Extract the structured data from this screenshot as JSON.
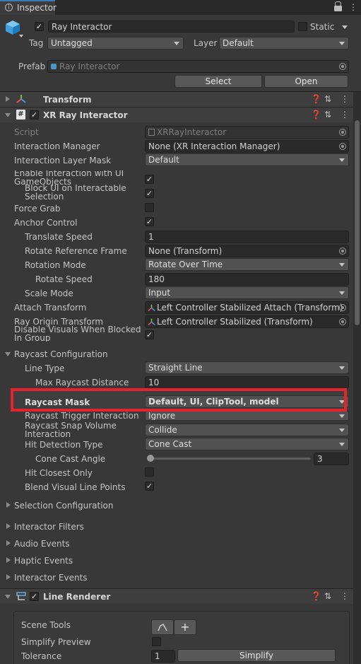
{
  "tab": {
    "title": "Inspector"
  },
  "object": {
    "name": "Ray Interactor",
    "static_label": "Static",
    "tag_label": "Tag",
    "tag_value": "Untagged",
    "layer_label": "Layer",
    "layer_value": "Default",
    "prefab_label": "Prefab",
    "prefab_value": "Ray Interactor",
    "select_label": "Select",
    "open_label": "Open"
  },
  "transform": {
    "title": "Transform"
  },
  "xr": {
    "title": "XR Ray Interactor",
    "script_label": "Script",
    "script_value": "XRRayInteractor",
    "interaction_manager_label": "Interaction Manager",
    "interaction_manager_value": "None (XR Interaction Manager)",
    "interaction_layer_mask_label": "Interaction Layer Mask",
    "interaction_layer_mask_value": "Default",
    "enable_ui_label": "Enable Interaction with UI GameObjects",
    "block_ui_label": "Block UI on Interactable Selection",
    "force_grab_label": "Force Grab",
    "anchor_control_label": "Anchor Control",
    "translate_speed_label": "Translate Speed",
    "translate_speed_value": "1",
    "rotate_ref_label": "Rotate Reference Frame",
    "rotate_ref_value": "None (Transform)",
    "rotation_mode_label": "Rotation Mode",
    "rotation_mode_value": "Rotate Over Time",
    "rotate_speed_label": "Rotate Speed",
    "rotate_speed_value": "180",
    "scale_mode_label": "Scale Mode",
    "scale_mode_value": "Input",
    "attach_transform_label": "Attach Transform",
    "attach_transform_value": "Left Controller Stabilized Attach (Transform)",
    "ray_origin_label": "Ray Origin Transform",
    "ray_origin_value": "Left Controller Stabilized (Transform)",
    "disable_visuals_label": "Disable Visuals When Blocked In Group"
  },
  "raycast": {
    "title": "Raycast Configuration",
    "line_type_label": "Line Type",
    "line_type_value": "Straight Line",
    "max_distance_label": "Max Raycast Distance",
    "max_distance_value": "10",
    "mask_label": "Raycast Mask",
    "mask_value": "Default, UI, ClipTool, model",
    "trigger_label": "Raycast Trigger Interaction",
    "trigger_value": "Ignore",
    "snap_label": "Raycast Snap Volume Interaction",
    "snap_value": "Collide",
    "hit_type_label": "Hit Detection Type",
    "hit_type_value": "Cone Cast",
    "cone_angle_label": "Cone Cast Angle",
    "cone_angle_value": "3",
    "cone_angle_fraction": 0.0,
    "hit_closest_label": "Hit Closest Only",
    "blend_label": "Blend Visual Line Points"
  },
  "foldouts": {
    "selection": "Selection Configuration",
    "filters": "Interactor Filters",
    "audio": "Audio Events",
    "haptic": "Haptic Events",
    "interactor": "Interactor Events"
  },
  "line_renderer": {
    "title": "Line Renderer",
    "scene_tools_label": "Scene Tools",
    "simplify_preview_label": "Simplify Preview",
    "tolerance_label": "Tolerance",
    "tolerance_value": "1",
    "simplify_label": "Simplify"
  },
  "checks": {
    "object_active": true,
    "static": false,
    "xr_enabled": true,
    "enable_ui": true,
    "block_ui": true,
    "force_grab": false,
    "anchor_control": true,
    "disable_visuals": true,
    "hit_closest": false,
    "blend": true,
    "lr_enabled": true,
    "simplify_preview": false
  },
  "colors": {
    "highlight": "#e5232d",
    "background": "#383838",
    "field": "#2a2a2a",
    "dropdown": "#515151"
  }
}
